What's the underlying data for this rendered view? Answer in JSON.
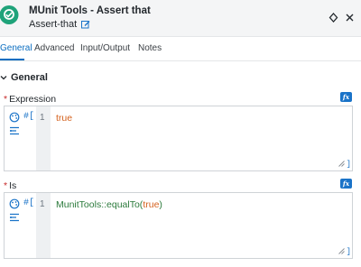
{
  "header": {
    "title": "MUnit Tools - Assert that",
    "subtitle": "Assert-that",
    "logo_color": "#1fa37a",
    "icons": [
      "munit-logo-icon",
      "edit-icon",
      "pin-icon",
      "close-icon"
    ]
  },
  "tabs": [
    {
      "label": "General",
      "active": true
    },
    {
      "label": "Advanced",
      "active": false
    },
    {
      "label": "Input/Output",
      "active": false
    },
    {
      "label": "Notes",
      "active": false
    }
  ],
  "section": {
    "title": "General",
    "expanded": true
  },
  "fields": {
    "expression": {
      "label": "Expression",
      "required_mark": "*",
      "fx_label": "fx",
      "prefix": "#[",
      "line_number": "1",
      "code": "true",
      "close_bracket": "]"
    },
    "is": {
      "label": "Is",
      "required_mark": "*",
      "fx_label": "fx",
      "prefix": "#[",
      "line_number": "1",
      "code_fn": "MunitTools::equalTo(",
      "code_arg": "true",
      "code_end": ")",
      "close_bracket": "]"
    }
  },
  "colors": {
    "accent": "#0b6ec1",
    "required": "#c62828",
    "string_token": "#d4611d",
    "function_token": "#2b7a3b"
  }
}
